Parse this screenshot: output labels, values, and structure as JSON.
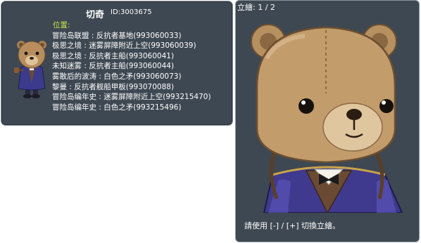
{
  "npc": {
    "name": "切奇",
    "id": "ID:3003675"
  },
  "locations": {
    "title": "位置:",
    "rows": [
      {
        "map": "冒险岛联盟",
        "area": "反抗者基地",
        "id": "(993060033)"
      },
      {
        "map": "极思之境",
        "area": "迷雾屏障附近上空",
        "id": "(993060039)"
      },
      {
        "map": "极思之境",
        "area": "反抗者主船",
        "id": "(993060041)"
      },
      {
        "map": "未知迷雾",
        "area": "反抗者主船",
        "id": "(993060044)"
      },
      {
        "map": "雾散后的波涛",
        "area": "白色之矛",
        "id": "(993060073)"
      },
      {
        "map": "黎曼",
        "area": "反抗者舰船甲板",
        "id": "(993070088)"
      },
      {
        "map": "冒险岛编年史",
        "area": "迷雾屏障附近上空",
        "id": "(993215470)"
      },
      {
        "map": "冒险岛编年史",
        "area": "白色之矛",
        "id": "(993215496)"
      }
    ],
    "separator": " : "
  },
  "portrait": {
    "counter": "立繪: 1 / 2",
    "hint": "請使用 [-] / [+] 切換立繪。"
  },
  "icons": {
    "avatar": "teddy-bear-npc-icon",
    "portrait": "teddy-bear-portrait"
  },
  "colors": {
    "panel_bg": "#3e4852",
    "panel_border": "#8b949c",
    "title_accent": "#c9e24a",
    "text": "#ffffff"
  }
}
